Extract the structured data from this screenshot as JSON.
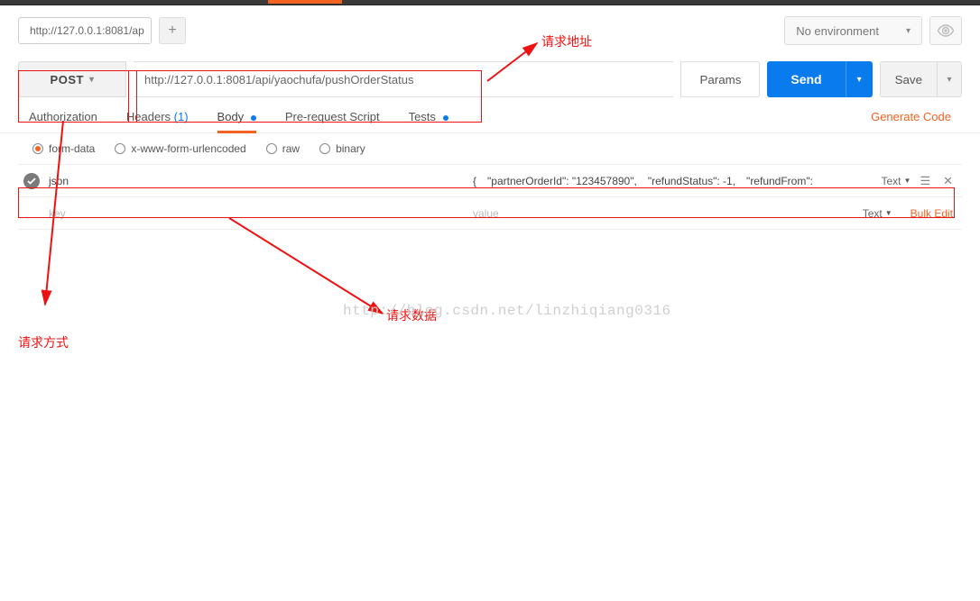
{
  "topbar": {},
  "header": {
    "tab_label": "http://127.0.0.1:8081/ap",
    "add_tab_symbol": "+",
    "env_label": "No environment"
  },
  "request": {
    "method": "POST",
    "url": "http://127.0.0.1:8081/api/yaochufa/pushOrderStatus",
    "params_label": "Params",
    "send_label": "Send",
    "save_label": "Save"
  },
  "tabs": {
    "authorization": "Authorization",
    "headers": "Headers",
    "headers_count": "(1)",
    "body": "Body",
    "prerequest": "Pre-request Script",
    "tests": "Tests",
    "generate_code": "Generate Code"
  },
  "body_types": {
    "form_data": "form-data",
    "urlencoded": "x-www-form-urlencoded",
    "raw": "raw",
    "binary": "binary"
  },
  "params": {
    "row0": {
      "key": "json",
      "value": "{　\"partnerOrderId\": \"123457890\",　\"refundStatus\": -1,　\"refundFrom\":",
      "type": "Text"
    },
    "placeholder_key": "key",
    "placeholder_value": "value",
    "placeholder_type": "Text",
    "bulk_edit": "Bulk Edit"
  },
  "annotations": {
    "url_label": "请求地址",
    "method_label": "请求方式",
    "data_label": "请求数据"
  },
  "watermark": "http://blog.csdn.net/linzhiqiang0316"
}
